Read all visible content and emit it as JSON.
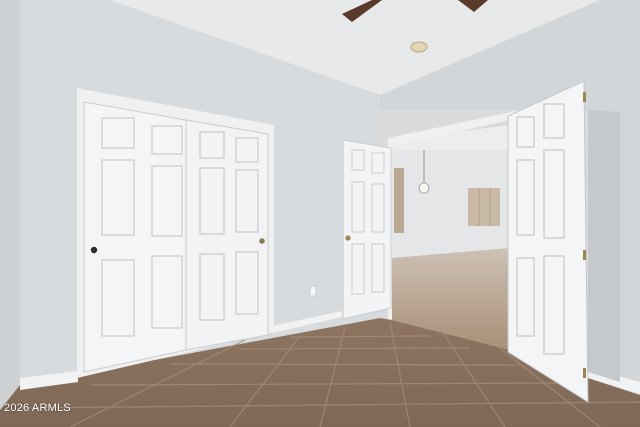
{
  "watermark": {
    "text": "2026 ARMLS"
  },
  "colors": {
    "wall": "#dcdfe1",
    "ceiling": "#e9eaeb",
    "door": "#f3f4f5",
    "floor": "#9a7f68",
    "grout": "#b19a85"
  }
}
